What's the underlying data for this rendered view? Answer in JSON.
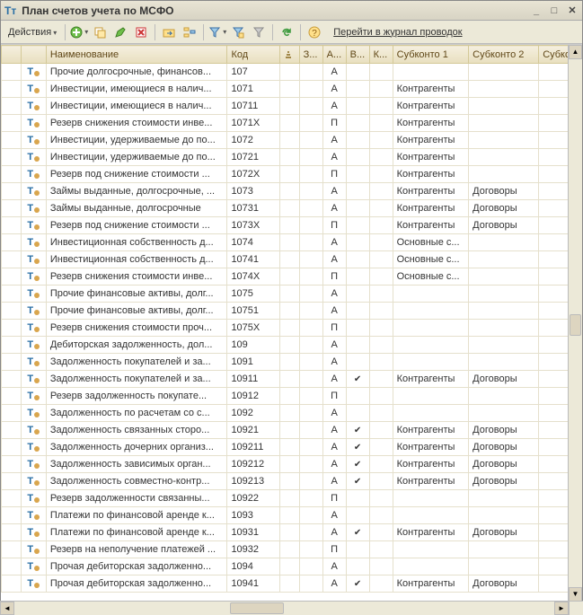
{
  "window": {
    "title": "План счетов учета по МСФО"
  },
  "toolbar": {
    "actions_label": "Действия",
    "journal_link": "Перейти в журнал проводок"
  },
  "columns": {
    "c2": "Наименование",
    "c3": "Код",
    "c4": "",
    "c5": "З...",
    "c6": "А...",
    "c7": "В...",
    "c8": "К...",
    "c9": "Субконто 1",
    "c10": "Субконто 2",
    "c11": "Субкон"
  },
  "rows": [
    {
      "name": "Прочие долгосрочные, финансов...",
      "code": "107",
      "type": "А",
      "v": "",
      "sub1": "",
      "sub2": ""
    },
    {
      "name": "Инвестиции, имеющиеся в налич...",
      "code": "1071",
      "type": "А",
      "v": "",
      "sub1": "Контрагенты",
      "sub2": ""
    },
    {
      "name": "Инвестиции, имеющиеся в налич...",
      "code": "10711",
      "type": "А",
      "v": "",
      "sub1": "Контрагенты",
      "sub2": ""
    },
    {
      "name": "Резерв снижения стоимости инве...",
      "code": "1071X",
      "type": "П",
      "v": "",
      "sub1": "Контрагенты",
      "sub2": ""
    },
    {
      "name": "Инвестиции, удерживаемые до по...",
      "code": "1072",
      "type": "А",
      "v": "",
      "sub1": "Контрагенты",
      "sub2": ""
    },
    {
      "name": "Инвестиции, удерживаемые до по...",
      "code": "10721",
      "type": "А",
      "v": "",
      "sub1": "Контрагенты",
      "sub2": ""
    },
    {
      "name": "Резерв под снижение стоимости ...",
      "code": "1072X",
      "type": "П",
      "v": "",
      "sub1": "Контрагенты",
      "sub2": ""
    },
    {
      "name": "Займы выданные, долгосрочные, ...",
      "code": "1073",
      "type": "А",
      "v": "",
      "sub1": "Контрагенты",
      "sub2": "Договоры"
    },
    {
      "name": "Займы выданные, долгосрочные",
      "code": "10731",
      "type": "А",
      "v": "",
      "sub1": "Контрагенты",
      "sub2": "Договоры"
    },
    {
      "name": "Резерв под снижение стоимости ...",
      "code": "1073X",
      "type": "П",
      "v": "",
      "sub1": "Контрагенты",
      "sub2": "Договоры"
    },
    {
      "name": "Инвестиционная собственность д...",
      "code": "1074",
      "type": "А",
      "v": "",
      "sub1": "Основные с...",
      "sub2": ""
    },
    {
      "name": "Инвестиционная собственность д...",
      "code": "10741",
      "type": "А",
      "v": "",
      "sub1": "Основные с...",
      "sub2": ""
    },
    {
      "name": "Резерв снижения стоимости инве...",
      "code": "1074X",
      "type": "П",
      "v": "",
      "sub1": "Основные с...",
      "sub2": ""
    },
    {
      "name": "Прочие финансовые активы, долг...",
      "code": "1075",
      "type": "А",
      "v": "",
      "sub1": "",
      "sub2": ""
    },
    {
      "name": "Прочие финансовые активы, долг...",
      "code": "10751",
      "type": "А",
      "v": "",
      "sub1": "",
      "sub2": ""
    },
    {
      "name": "Резерв снижения стоимости проч...",
      "code": "1075X",
      "type": "П",
      "v": "",
      "sub1": "",
      "sub2": ""
    },
    {
      "name": "Дебиторская задолженность, дол...",
      "code": "109",
      "type": "А",
      "v": "",
      "sub1": "",
      "sub2": ""
    },
    {
      "name": "Задолженность покупателей и за...",
      "code": "1091",
      "type": "А",
      "v": "",
      "sub1": "",
      "sub2": ""
    },
    {
      "name": "Задолженность покупателей и за...",
      "code": "10911",
      "type": "А",
      "v": "✔",
      "sub1": "Контрагенты",
      "sub2": "Договоры"
    },
    {
      "name": "Резерв задолженность покупате...",
      "code": "10912",
      "type": "П",
      "v": "",
      "sub1": "",
      "sub2": ""
    },
    {
      "name": "Задолженность по расчетам со с...",
      "code": "1092",
      "type": "А",
      "v": "",
      "sub1": "",
      "sub2": ""
    },
    {
      "name": "Задолженность связанных сторо...",
      "code": "10921",
      "type": "А",
      "v": "✔",
      "sub1": "Контрагенты",
      "sub2": "Договоры"
    },
    {
      "name": "Задолженность дочерних организ...",
      "code": "109211",
      "type": "А",
      "v": "✔",
      "sub1": "Контрагенты",
      "sub2": "Договоры"
    },
    {
      "name": "Задолженность зависимых орган...",
      "code": "109212",
      "type": "А",
      "v": "✔",
      "sub1": "Контрагенты",
      "sub2": "Договоры"
    },
    {
      "name": "Задолженность совместно-контр...",
      "code": "109213",
      "type": "А",
      "v": "✔",
      "sub1": "Контрагенты",
      "sub2": "Договоры"
    },
    {
      "name": "Резерв задолженности связанны...",
      "code": "10922",
      "type": "П",
      "v": "",
      "sub1": "",
      "sub2": ""
    },
    {
      "name": "Платежи по финансовой аренде к...",
      "code": "1093",
      "type": "А",
      "v": "",
      "sub1": "",
      "sub2": ""
    },
    {
      "name": "Платежи по финансовой аренде к...",
      "code": "10931",
      "type": "А",
      "v": "✔",
      "sub1": "Контрагенты",
      "sub2": "Договоры"
    },
    {
      "name": "Резерв на неполучение платежей ...",
      "code": "10932",
      "type": "П",
      "v": "",
      "sub1": "",
      "sub2": ""
    },
    {
      "name": "Прочая дебиторская задолженно...",
      "code": "1094",
      "type": "А",
      "v": "",
      "sub1": "",
      "sub2": ""
    },
    {
      "name": "Прочая дебиторская задолженно...",
      "code": "10941",
      "type": "А",
      "v": "✔",
      "sub1": "Контрагенты",
      "sub2": "Договоры"
    }
  ]
}
